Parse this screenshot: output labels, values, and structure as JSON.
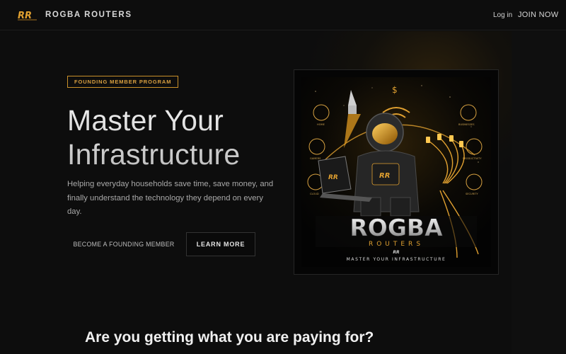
{
  "nav": {
    "brand": "ROGBA ROUTERS",
    "login_label": "Log in",
    "join_label": "JOIN NOW"
  },
  "hero": {
    "badge": "FOUNDING MEMBER PROGRAM",
    "headline_line1": "Master Your",
    "headline_line2": "Infrastructure",
    "subtitle": "Helping everyday households save time, save money, and finally understand the technology they depend on every day.",
    "primary_cta": "BECOME A FOUNDING MEMBER",
    "secondary_cta": "LEARN MORE"
  },
  "hero_image": {
    "wordmark": "ROGBA",
    "sub_wordmark": "ROUTERS",
    "tagline": "MASTER YOUR INFRASTRUCTURE",
    "monogram": "RR",
    "icon_labels_left": [
      "HOME",
      "GAMERS",
      "CLOUD"
    ],
    "icon_labels_right": [
      "BUSINESSES",
      "PRODUCTIVITY",
      "SECURITY"
    ]
  },
  "section": {
    "title": "Are you getting what you are paying for?"
  },
  "colors": {
    "accent_gold": "#d9a040",
    "background": "#0d0d0d"
  }
}
